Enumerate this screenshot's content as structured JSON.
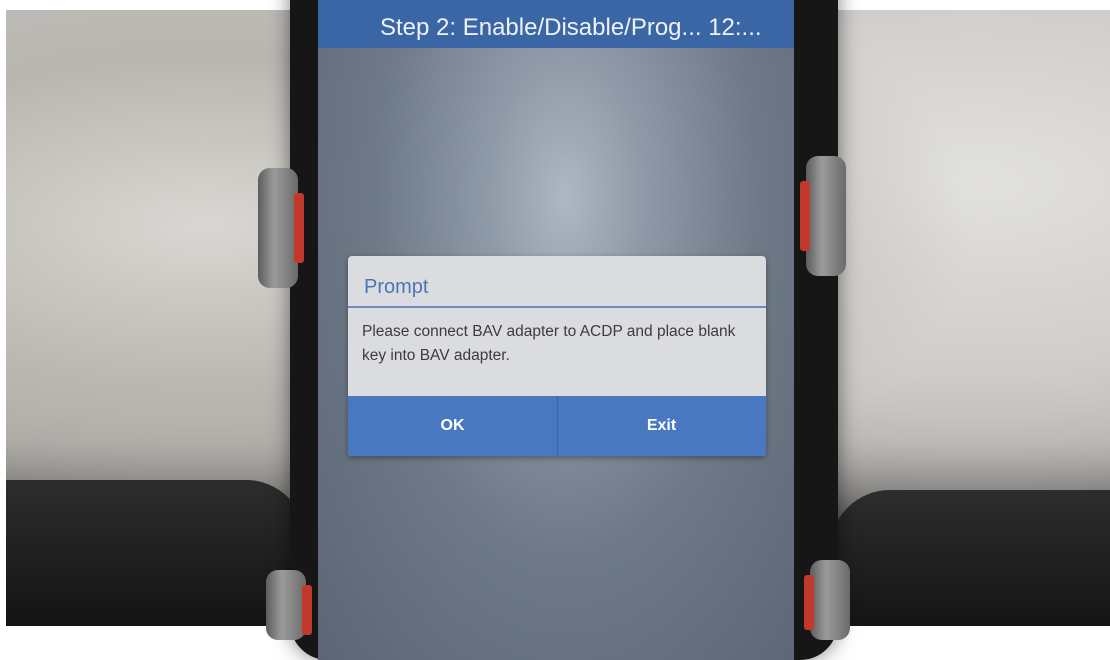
{
  "app": {
    "title": "Step 2: Enable/Disable/Prog... 12:..."
  },
  "dialog": {
    "title": "Prompt",
    "message": "Please connect BAV adapter to ACDP and place blank key into BAV adapter.",
    "ok_label": "OK",
    "exit_label": "Exit"
  },
  "colors": {
    "title_bar": "#3b66a5",
    "dialog_accent": "#4a76b7",
    "button_bar": "#4878c0"
  }
}
